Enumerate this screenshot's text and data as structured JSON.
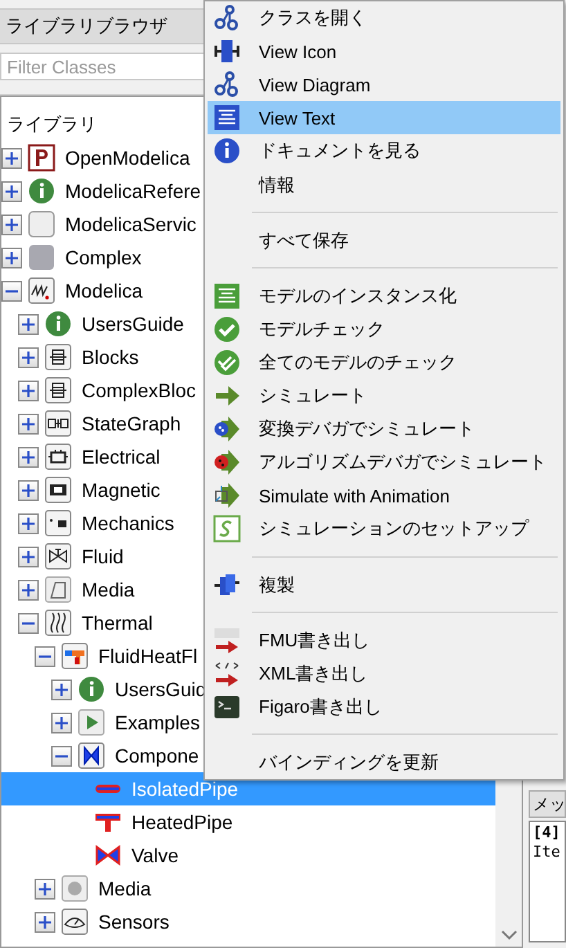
{
  "library_browser": {
    "title": "ライブラリブラウザ",
    "filter": {
      "placeholder": "Filter Classes"
    },
    "tree_header": "ライブラリ",
    "tree": [
      {
        "label": "OpenModelica",
        "kind": "p-logo",
        "expanded": false,
        "selected": false
      },
      {
        "label": "ModelicaRefere",
        "kind": "info",
        "expanded": false,
        "selected": false
      },
      {
        "label": "ModelicaServic",
        "kind": "blank",
        "expanded": false,
        "selected": false
      },
      {
        "label": "Complex",
        "kind": "grey",
        "expanded": false,
        "selected": false
      },
      {
        "label": "Modelica",
        "kind": "spring",
        "expanded": true,
        "selected": false,
        "children": [
          {
            "label": "UsersGuide",
            "kind": "info",
            "expanded": false,
            "selected": false
          },
          {
            "label": "Blocks",
            "kind": "block",
            "expanded": false,
            "selected": false
          },
          {
            "label": "ComplexBloc",
            "kind": "block",
            "expanded": false,
            "selected": false
          },
          {
            "label": "StateGraph",
            "kind": "stategraph",
            "expanded": false,
            "selected": false
          },
          {
            "label": "Electrical",
            "kind": "electrical",
            "expanded": false,
            "selected": false
          },
          {
            "label": "Magnetic",
            "kind": "magnetic",
            "expanded": false,
            "selected": false
          },
          {
            "label": "Mechanics",
            "kind": "mechanics",
            "expanded": false,
            "selected": false
          },
          {
            "label": "Fluid",
            "kind": "valve",
            "expanded": false,
            "selected": false
          },
          {
            "label": "Media",
            "kind": "media",
            "expanded": false,
            "selected": false
          },
          {
            "label": "Thermal",
            "kind": "thermal",
            "expanded": true,
            "selected": false,
            "children": [
              {
                "label": "FluidHeatFl",
                "kind": "fluidheat",
                "expanded": true,
                "selected": false,
                "children": [
                  {
                    "label": "UsersGuid",
                    "kind": "info",
                    "expanded": false,
                    "selected": false
                  },
                  {
                    "label": "Examples",
                    "kind": "play",
                    "expanded": false,
                    "selected": false
                  },
                  {
                    "label": "Compone",
                    "kind": "component",
                    "expanded": true,
                    "selected": false,
                    "children": [
                      {
                        "label": "IsolatedPipe",
                        "kind": "pipe",
                        "selected": true
                      },
                      {
                        "label": "HeatedPipe",
                        "kind": "heatedpipe",
                        "selected": false
                      },
                      {
                        "label": "Valve",
                        "kind": "redvalve",
                        "selected": false
                      }
                    ]
                  }
                ]
              },
              {
                "label": "Media",
                "kind": "ball",
                "expanded": false,
                "selected": false
              },
              {
                "label": "Sensors",
                "kind": "sensor",
                "expanded": false,
                "selected": false
              }
            ]
          }
        ]
      }
    ]
  },
  "messages": {
    "tab": "メッ",
    "lines": [
      {
        "text": "[4]",
        "bold": true
      },
      {
        "text": "Ite",
        "bold": false
      }
    ]
  },
  "context_menu": [
    {
      "kind": "gears",
      "label": "クラスを開く",
      "selected": false
    },
    {
      "kind": "block",
      "label": "View Icon",
      "selected": false
    },
    {
      "kind": "gears",
      "label": "View Diagram",
      "selected": false
    },
    {
      "kind": "text",
      "label": "View Text",
      "selected": true
    },
    {
      "kind": "info",
      "label": "ドキュメントを見る",
      "selected": false
    },
    {
      "kind": "plain",
      "label": "情報",
      "selected": false
    },
    {
      "kind": "separator"
    },
    {
      "kind": "plain",
      "label": "すべて保存",
      "selected": false
    },
    {
      "kind": "separator"
    },
    {
      "kind": "instantiate",
      "label": "モデルのインスタンス化",
      "selected": false
    },
    {
      "kind": "check",
      "label": "モデルチェック",
      "selected": false
    },
    {
      "kind": "checkall",
      "label": "全てのモデルのチェック",
      "selected": false
    },
    {
      "kind": "simulate",
      "label": "シミュレート",
      "selected": false
    },
    {
      "kind": "debug",
      "label": "変換デバガでシミュレート",
      "selected": false
    },
    {
      "kind": "algdebug",
      "label": "アルゴリズムデバガでシミュレート",
      "selected": false
    },
    {
      "kind": "animate",
      "label": "Simulate with Animation",
      "selected": false
    },
    {
      "kind": "setup",
      "label": "シミュレーションのセットアップ",
      "selected": false
    },
    {
      "kind": "separator"
    },
    {
      "kind": "duplicate",
      "label": "複製",
      "selected": false
    },
    {
      "kind": "separator"
    },
    {
      "kind": "fmu",
      "label": "FMU書き出し",
      "selected": false
    },
    {
      "kind": "xml",
      "label": "XML書き出し",
      "selected": false
    },
    {
      "kind": "terminal",
      "label": "Figaro書き出し",
      "selected": false
    },
    {
      "kind": "separator"
    },
    {
      "kind": "plain",
      "label": "バインディングを更新",
      "selected": false
    }
  ]
}
